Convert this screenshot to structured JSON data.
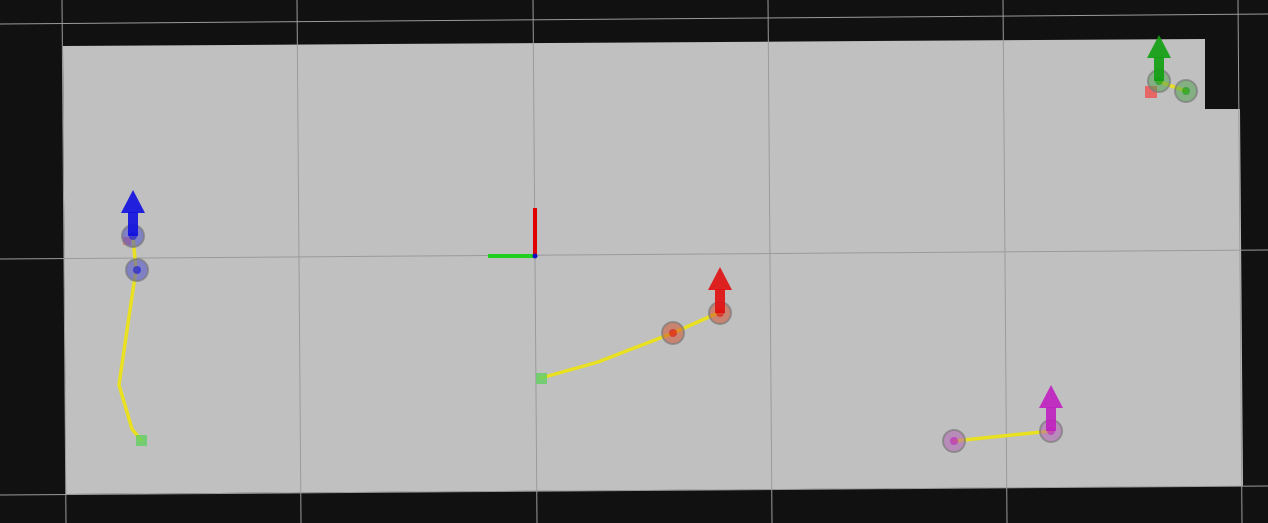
{
  "viewport": {
    "background_color": "#111111",
    "floor_color": "#c0c0c0",
    "grid_color": "#9a9a9a"
  },
  "origin_axes": {
    "x_axis_color": "#e00000",
    "y_axis_color": "#20d020",
    "z_axis_color": "#1010c0"
  },
  "robots": [
    {
      "id": "blue",
      "color": "#1010e0",
      "marker_color": "#4a4ac8",
      "arrow_icon": "arrow-up-icon",
      "goal_marker_icon": "goal-square-icon",
      "goal_color": "#60d060"
    },
    {
      "id": "red",
      "color": "#e01010",
      "marker_color": "#d05030",
      "arrow_icon": "arrow-up-icon",
      "goal_marker_icon": "goal-square-icon",
      "goal_color": "#60d060"
    },
    {
      "id": "magenta",
      "color": "#c020c0",
      "marker_color": "#b060b0",
      "arrow_icon": "arrow-up-icon",
      "goal_marker_icon": "",
      "goal_color": ""
    },
    {
      "id": "green",
      "color": "#10a010",
      "marker_color": "#50a050",
      "arrow_icon": "arrow-up-icon",
      "goal_marker_icon": "goal-square-icon",
      "goal_color": "#f05050"
    }
  ],
  "path_color": "#e8e020"
}
